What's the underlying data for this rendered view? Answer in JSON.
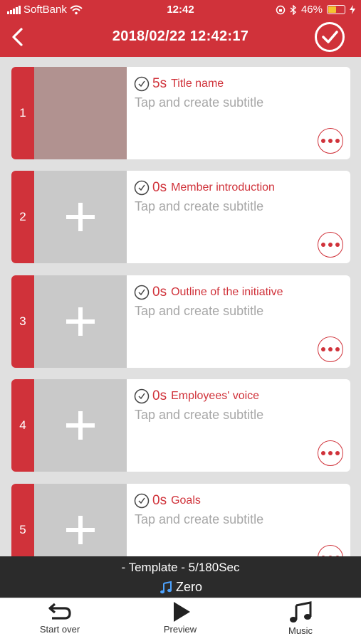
{
  "status": {
    "carrier": "SoftBank",
    "time": "12:42",
    "battery": "46%"
  },
  "header": {
    "title": "2018/02/22 12:42:17"
  },
  "scenes": [
    {
      "number": "1",
      "duration": "5s",
      "title": "Title name",
      "subtitle": "Tap and create subtitle",
      "has_image": true
    },
    {
      "number": "2",
      "duration": "0s",
      "title": "Member introduction",
      "subtitle": "Tap and create subtitle",
      "has_image": false
    },
    {
      "number": "3",
      "duration": "0s",
      "title": "Outline of the initiative",
      "subtitle": "Tap and create subtitle",
      "has_image": false
    },
    {
      "number": "4",
      "duration": "0s",
      "title": "Employees' voice",
      "subtitle": "Tap and create subtitle",
      "has_image": false
    },
    {
      "number": "5",
      "duration": "0s",
      "title": "Goals",
      "subtitle": "Tap and create subtitle",
      "has_image": false
    }
  ],
  "template_bar": {
    "info": "- Template - 5/180Sec",
    "music": "Zero"
  },
  "tabs": {
    "start_over": "Start over",
    "preview": "Preview",
    "music": "Music"
  },
  "colors": {
    "accent": "#d0323a",
    "background": "#e0e0e0",
    "dark_bar": "#2b2b2b"
  }
}
